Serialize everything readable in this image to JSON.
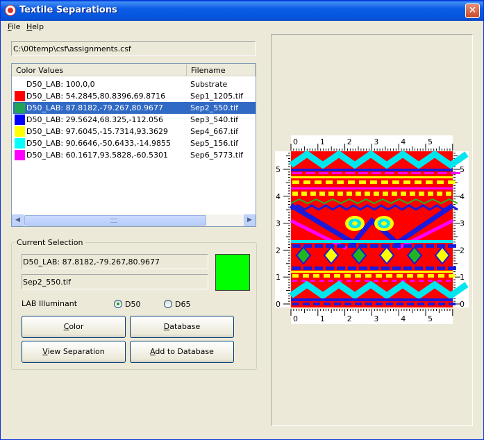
{
  "window": {
    "title": "Textile Separations",
    "close_glyph": "✕"
  },
  "menu": {
    "file": "File",
    "help": "Help"
  },
  "path": "C:\\00temp\\csf\\assignments.csf",
  "list": {
    "headers": {
      "color_values": "Color Values",
      "filename": "Filename"
    },
    "rows": [
      {
        "value": "D50_LAB: 100,0,0",
        "file": "Substrate",
        "color": ""
      },
      {
        "value": "D50_LAB: 54.2845,80.8396,69.8716",
        "file": "Sep1_1205.tif",
        "color": "#ff0000"
      },
      {
        "value": "D50_LAB: 87.8182,-79.267,80.9677",
        "file": "Sep2_550.tif",
        "color": "#22a552"
      },
      {
        "value": "D50_LAB: 29.5624,68.325,-112.056",
        "file": "Sep3_540.tif",
        "color": "#0000ff"
      },
      {
        "value": "D50_LAB: 97.6045,-15.7314,93.3629",
        "file": "Sep4_667.tif",
        "color": "#ffff00"
      },
      {
        "value": "D50_LAB: 90.6646,-50.6433,-14.9855",
        "file": "Sep5_156.tif",
        "color": "#00ffff"
      },
      {
        "value": "D50_LAB: 60.1617,93.5828,-60.5301",
        "file": "Sep6_5773.tif",
        "color": "#ff00ff"
      }
    ],
    "selected_index": 2
  },
  "current_selection": {
    "label": "Current Selection",
    "value": "D50_LAB: 87.8182,-79.267,80.9677",
    "file": "Sep2_550.tif",
    "preview_color": "#00ff00",
    "illuminant_label": "LAB Illuminant",
    "options": [
      "D50",
      "D65"
    ],
    "selected_option": "D50"
  },
  "buttons": {
    "color": "Color",
    "database": "Database",
    "view_separation": "View Separation",
    "add_to_database": "Add to Database"
  },
  "preview": {
    "x_ticks": [
      "0",
      "1",
      "2",
      "3",
      "4",
      "5"
    ],
    "y_ticks": [
      "5",
      "4",
      "3",
      "2",
      "1",
      "0"
    ]
  },
  "colors": {
    "red": "#ff0000",
    "cyan": "#00e5ee",
    "blue": "#1a1adc",
    "yellow": "#ffff00",
    "magenta": "#ff00ff",
    "green": "#21b621",
    "selection": "#316ac5"
  }
}
